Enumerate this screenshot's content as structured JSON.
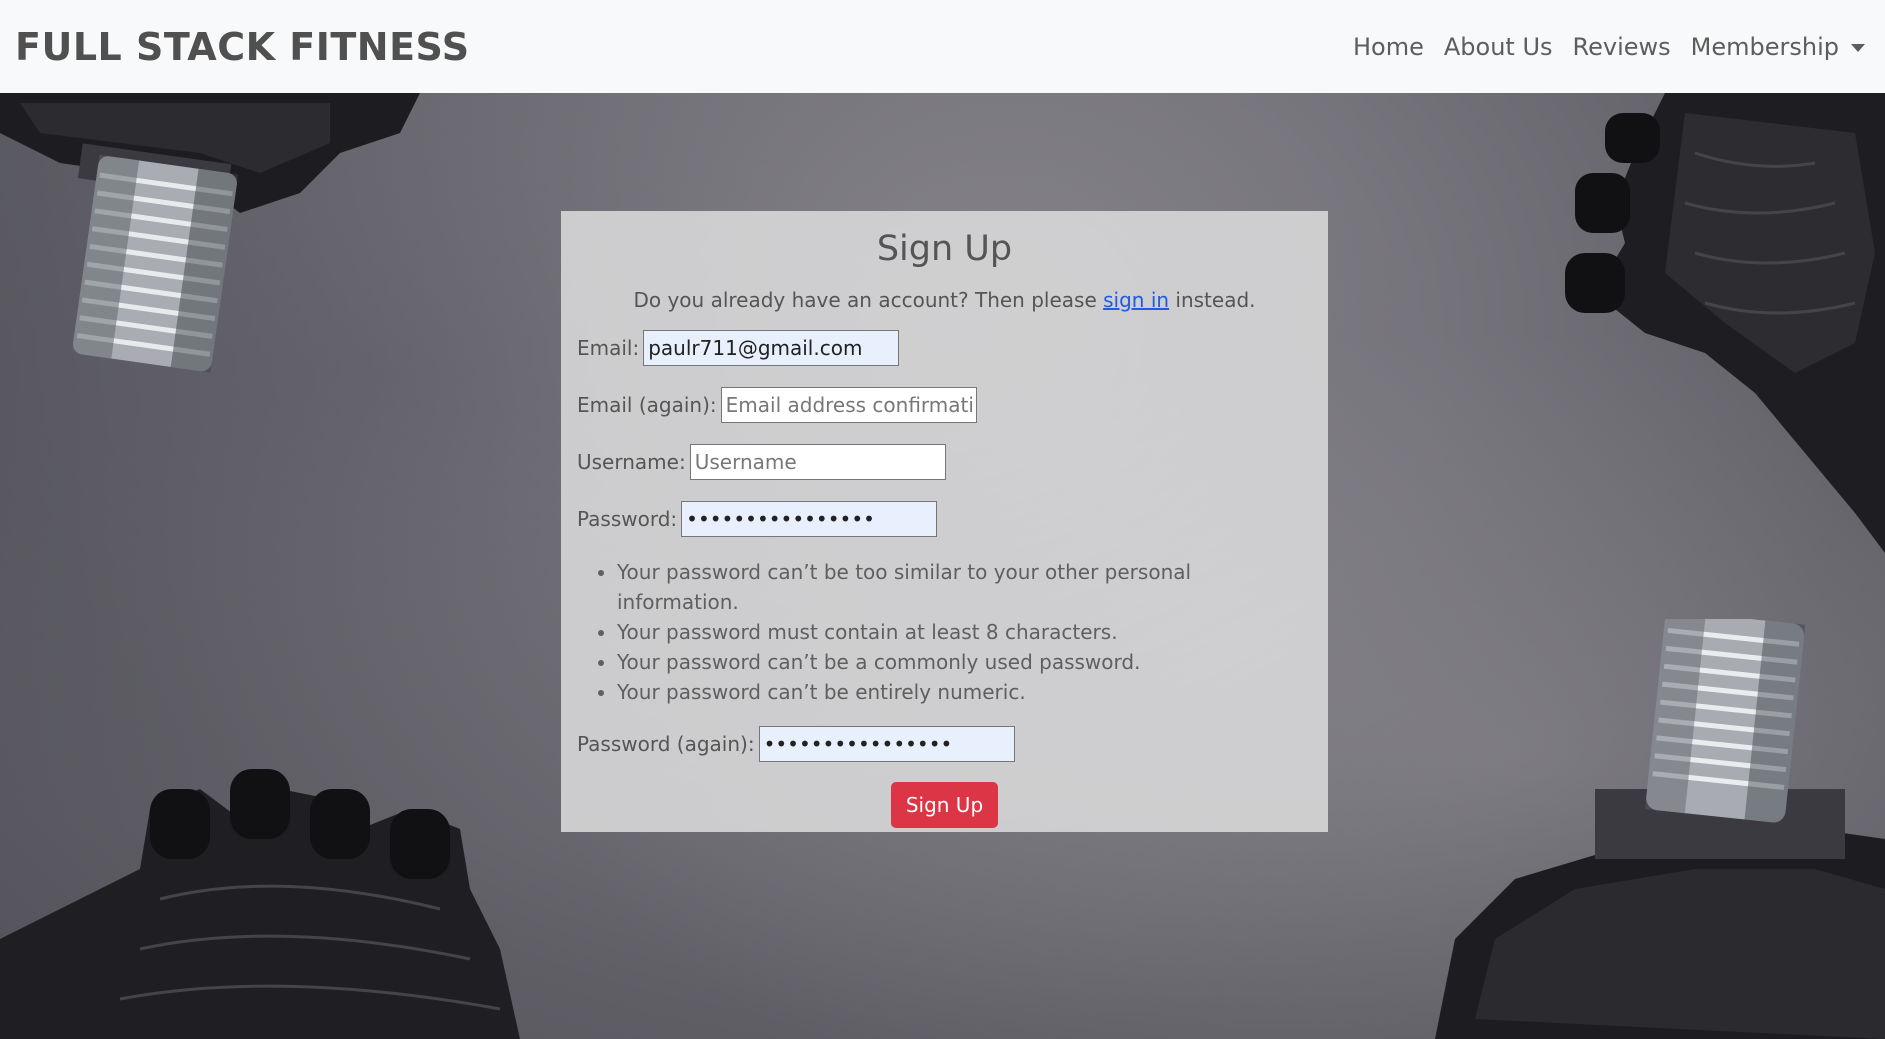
{
  "navbar": {
    "brand": "FULL STACK FITNESS",
    "links": [
      "Home",
      "About Us",
      "Reviews"
    ],
    "dropdown_label": "Membership"
  },
  "form": {
    "title": "Sign Up",
    "intro_before": "Do you already have an account? Then please ",
    "intro_link": "sign in",
    "intro_after": " instead.",
    "email_label": "Email:",
    "email_value": "paulr711@gmail.com",
    "email_again_label": "Email (again):",
    "email_again_placeholder": "Email address confirmation",
    "username_label": "Username:",
    "username_placeholder": "Username",
    "password_label": "Password:",
    "password_value": "passwordpassword",
    "help_items": [
      "Your password can’t be too similar to your other personal information.",
      "Your password must contain at least 8 characters.",
      "Your password can’t be a commonly used password.",
      "Your password can’t be entirely numeric."
    ],
    "password_again_label": "Password (again):",
    "password_again_value": "passwordpassword",
    "submit_label": "Sign Up"
  },
  "colors": {
    "navbar_bg": "#f8f9fa",
    "brand_text": "#505050",
    "button_bg": "#dc3545",
    "link": "#1f5ce0"
  }
}
